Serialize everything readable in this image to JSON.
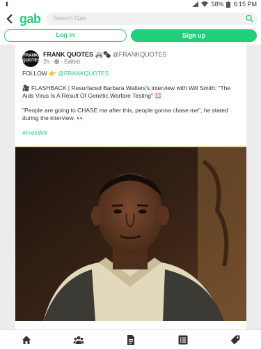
{
  "statusbar": {
    "download_glyph": "⬇",
    "battery": "58%",
    "time": "6:15 PM",
    "icons": [
      "download-icon",
      "signal-icon",
      "wifi-icon",
      "battery-icon"
    ]
  },
  "header": {
    "logo": "gab",
    "search_placeholder": "Search Gab"
  },
  "auth": {
    "login_label": "Log in",
    "signup_label": "Sign up"
  },
  "post": {
    "avatar_text": "FRANK QUOTES",
    "author_name": "FRANK QUOTES 🚑🗞",
    "author_handle": "@FRANKQUOTES",
    "time": "2h",
    "edited": "Edited",
    "follow_prefix": "FOLLOW 👉",
    "follow_handle": "@FRANKQUOTES",
    "paragraph1": "🎥 FLASHBACK | Resurfaced Barbara Walters's interview with Will Smith: \"The Aids Virus Is A Result Of Genetic Warfare Testing\" 💢",
    "paragraph2": "\"People are going to CHASE me after this, people gonna chase me\", he stated during the interview. 👀",
    "hashtag": "#FreeWill",
    "media": "video-thumbnail"
  },
  "navbar": {
    "items": [
      "home-icon",
      "groups-icon",
      "news-icon",
      "lists-icon",
      "shop-icon"
    ]
  },
  "colors": {
    "accent": "#21cf7a",
    "background": "#ececec",
    "surface": "#ffffff"
  }
}
